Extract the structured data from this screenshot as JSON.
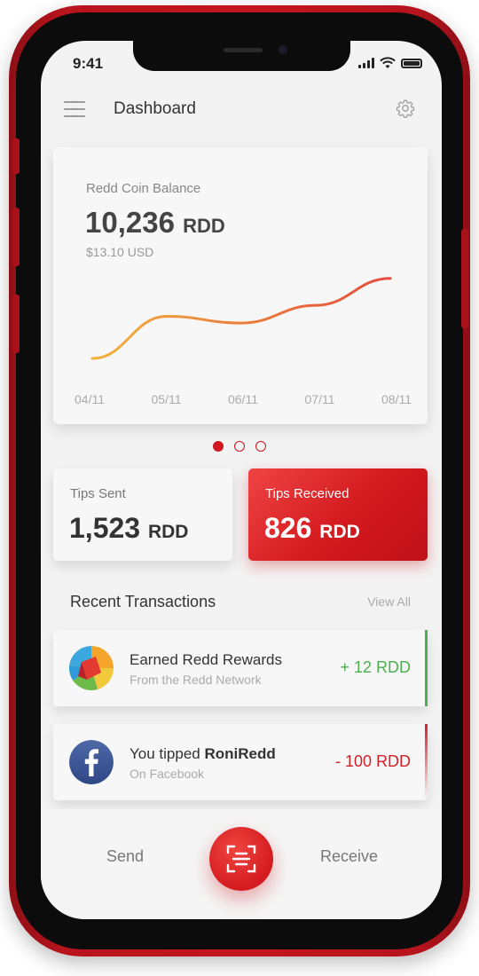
{
  "status": {
    "time": "9:41"
  },
  "header": {
    "title": "Dashboard"
  },
  "balance": {
    "label": "Redd Coin Balance",
    "amount": "10,236",
    "unit": "RDD",
    "usd": "$13.10 USD"
  },
  "chart_data": {
    "type": "line",
    "x": [
      "04/11",
      "05/11",
      "06/11",
      "07/11",
      "08/11"
    ],
    "series": [
      {
        "values": [
          0.0,
          0.5,
          0.42,
          0.63,
          0.95
        ]
      }
    ],
    "colors": [
      "#f2b33d",
      "#e54a3d"
    ]
  },
  "pagination": {
    "pages": 3,
    "active": 0
  },
  "tips": {
    "sent": {
      "label": "Tips Sent",
      "amount": "1,523",
      "unit": "RDD"
    },
    "received": {
      "label": "Tips Received",
      "amount": "826",
      "unit": "RDD"
    }
  },
  "recent": {
    "title": "Recent Transactions",
    "view_all": "View All",
    "items": [
      {
        "icon": "redd-network-icon",
        "title": "Earned Redd Rewards",
        "subtitle": "From the Redd Network",
        "amount": "+ 12 RDD",
        "color": "#4caf50"
      },
      {
        "icon": "facebook-icon",
        "title_prefix": "You tipped ",
        "title_user": "RoniRedd",
        "subtitle": "On Facebook",
        "amount": "- 100 RDD",
        "color": "#d3212a"
      }
    ]
  },
  "bottom_nav": {
    "send": "Send",
    "receive": "Receive",
    "scan_icon": "qr-scan-icon"
  }
}
